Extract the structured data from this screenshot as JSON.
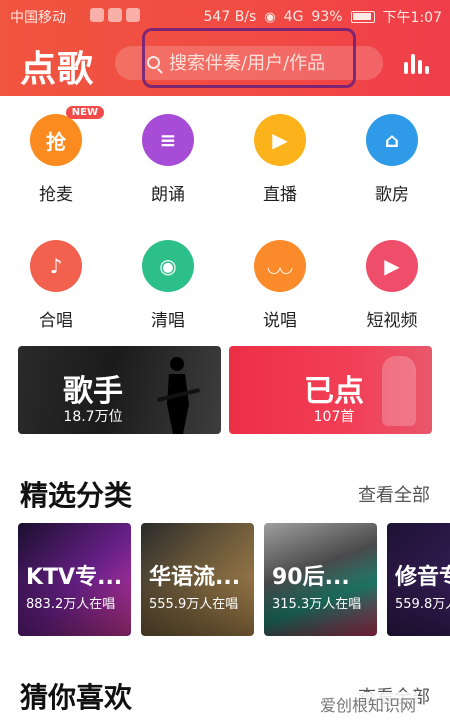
{
  "status_bar": {
    "carrier": "中国移动",
    "speed": "547 B/s",
    "network": "4G",
    "battery": "93%",
    "time": "下午1:07"
  },
  "header": {
    "title": "点歌",
    "search_placeholder": "搜索伴奏/用户/作品",
    "search_icon": "search-icon",
    "ranking_icon": "bar-chart-icon"
  },
  "quick_items": [
    {
      "label": "抢麦",
      "icon": "grab-mic-icon",
      "color": "#fb8b1e",
      "glyph": "抢",
      "badge": "NEW"
    },
    {
      "label": "朗诵",
      "icon": "recite-icon",
      "color": "#a64cd6",
      "glyph": "≡"
    },
    {
      "label": "直播",
      "icon": "live-icon",
      "color": "#fbb21b",
      "glyph": "▶"
    },
    {
      "label": "歌房",
      "icon": "song-room-icon",
      "color": "#2f9be8",
      "glyph": "⌂"
    },
    {
      "label": "合唱",
      "icon": "chorus-icon",
      "color": "#f2614d",
      "glyph": "♪"
    },
    {
      "label": "清唱",
      "icon": "acapella-icon",
      "color": "#2dbf8a",
      "glyph": "◉"
    },
    {
      "label": "说唱",
      "icon": "rap-icon",
      "color": "#fb8a2a",
      "glyph": "◡◡"
    },
    {
      "label": "短视频",
      "icon": "short-video-icon",
      "color": "#ef4e6a",
      "glyph": "▶"
    }
  ],
  "banners": {
    "singer": {
      "title": "歌手",
      "subtitle": "18.7万位"
    },
    "ordered": {
      "title": "已点",
      "subtitle": "107首"
    }
  },
  "featured": {
    "title": "精选分类",
    "more": "查看全部",
    "cards": [
      {
        "title": "KTV专...",
        "subtitle": "883.2万人在唱",
        "color": "#3a1452"
      },
      {
        "title": "华语流...",
        "subtitle": "555.9万人在唱",
        "color": "#3d3425"
      },
      {
        "title": "90后...",
        "subtitle": "315.3万人在唱",
        "color": "#2c6b5e"
      },
      {
        "title": "修音专",
        "subtitle": "559.8万人",
        "color": "#2a1744"
      }
    ]
  },
  "guess": {
    "title": "猜你喜欢",
    "more": "查看全部"
  },
  "watermark": "爱创根知识网"
}
